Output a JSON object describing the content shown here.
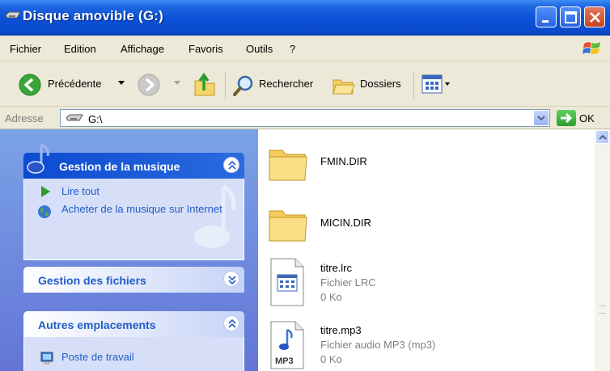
{
  "window": {
    "title": "Disque amovible (G:)",
    "icon": "removable-drive-icon"
  },
  "menu": {
    "items": [
      "Fichier",
      "Edition",
      "Affichage",
      "Favoris",
      "Outils",
      "?"
    ]
  },
  "toolbar": {
    "back_label": "Précédente",
    "search_label": "Rechercher",
    "folders_label": "Dossiers"
  },
  "address": {
    "label": "Adresse",
    "value": "G:\\",
    "go_label": "OK"
  },
  "tasks": {
    "music": {
      "title": "Gestion de la musique",
      "items": [
        "Lire tout",
        "Acheter de la musique sur Internet"
      ]
    },
    "files": {
      "title": "Gestion des fichiers"
    },
    "places": {
      "title": "Autres emplacements",
      "items": [
        "Poste de travail"
      ]
    }
  },
  "files": [
    {
      "name": "FMIN.DIR",
      "icon": "folder-icon"
    },
    {
      "name": "MICIN.DIR",
      "icon": "folder-icon"
    },
    {
      "name": "titre.lrc",
      "type": "Fichier LRC",
      "size": "0 Ko",
      "icon": "lrc-file-icon"
    },
    {
      "name": "titre.mp3",
      "type": "Fichier audio MP3 (mp3)",
      "size": "0 Ko",
      "icon": "mp3-file-icon",
      "badge": "MP3"
    }
  ],
  "colors": {
    "titlebar": "#0a4fd6",
    "taskpane": "#6375d6",
    "link": "#215dc6",
    "chrome": "#ece9d8"
  }
}
